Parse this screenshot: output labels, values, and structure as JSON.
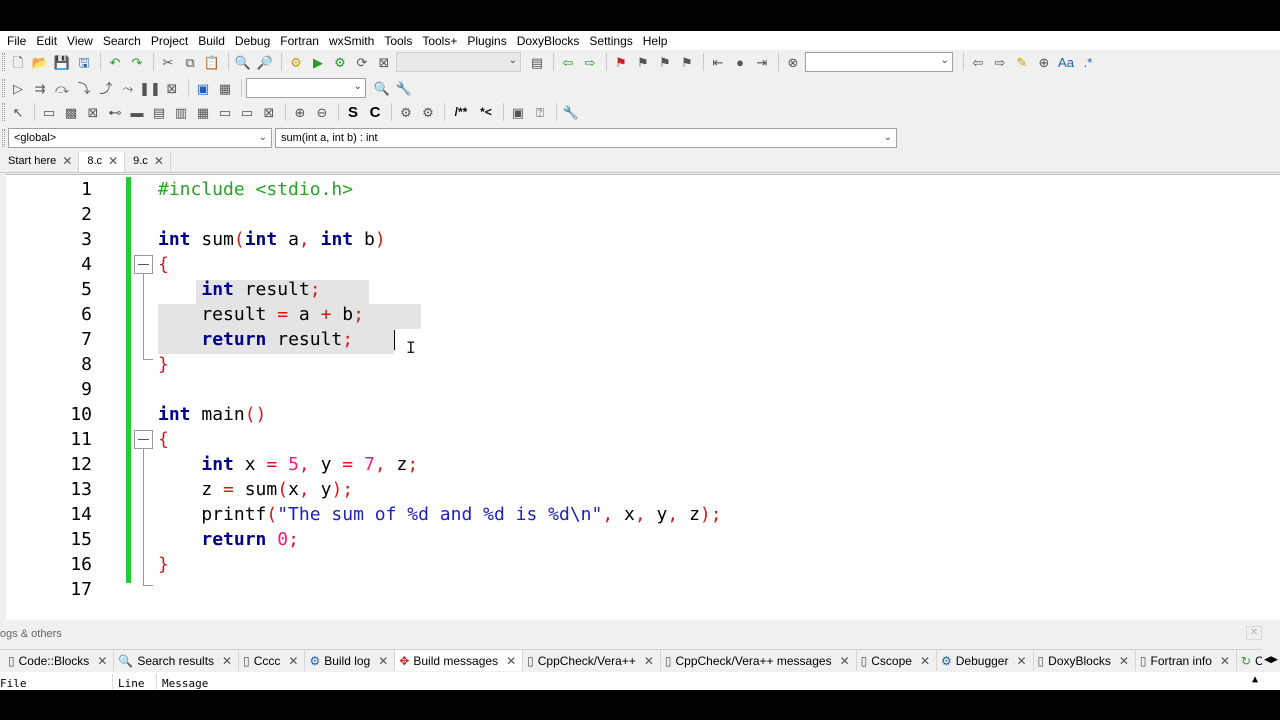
{
  "menu": [
    "File",
    "Edit",
    "View",
    "Search",
    "Project",
    "Build",
    "Debug",
    "Fortran",
    "wxSmith",
    "Tools",
    "Tools+",
    "Plugins",
    "DoxyBlocks",
    "Settings",
    "Help"
  ],
  "toolbar": {
    "row3_comment_label": "/**",
    "row3_comment2_label": "*<",
    "row3_s": "S",
    "row3_c": "C",
    "search_combo_value": "",
    "jump_combo_value": "",
    "build_target_value": ""
  },
  "scope": {
    "scope_value": "<global>",
    "function_value": "sum(int a, int b) : int"
  },
  "tabs": [
    {
      "label": "Start here"
    },
    {
      "label": "8.c"
    },
    {
      "label": "9.c"
    }
  ],
  "editor": {
    "line_numbers": [
      "1",
      "2",
      "3",
      "4",
      "5",
      "6",
      "7",
      "8",
      "9",
      "10",
      "11",
      "12",
      "13",
      "14",
      "15",
      "16",
      "17"
    ]
  },
  "logs": {
    "header": "ogs & others",
    "tabs": [
      "Code::Blocks",
      "Search results",
      "Cccc",
      "Build log",
      "Build messages",
      "CppCheck/Vera++",
      "CppCheck/Vera++ messages",
      "Cscope",
      "Debugger",
      "DoxyBlocks",
      "Fortran info",
      "Cl"
    ],
    "active_tab": "Build messages",
    "columns": [
      "File",
      "Line",
      "Message"
    ]
  },
  "colors": {
    "preprocessor": "#27a127",
    "keyword": "#00008b",
    "operator": "#d11a1a",
    "number": "#f0207a",
    "string": "#2020c0",
    "change_bar": "#22cc33",
    "selection": "#e4e4e4"
  }
}
